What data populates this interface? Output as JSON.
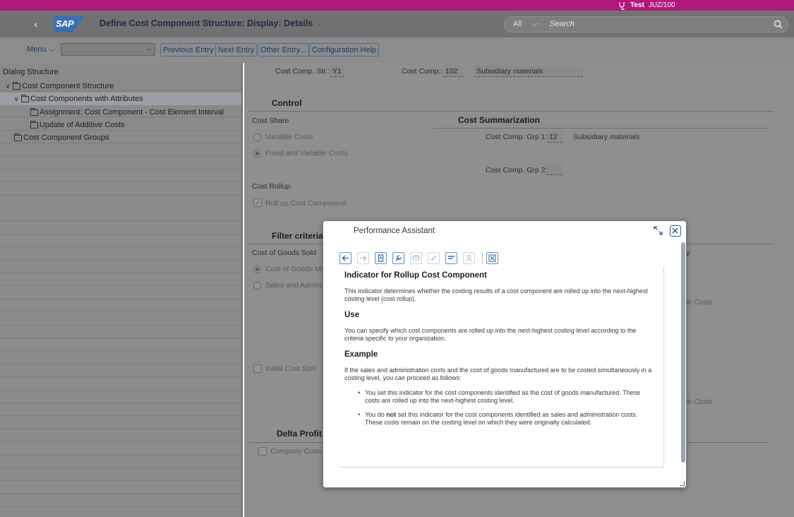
{
  "system": {
    "user": "Test",
    "client": "JUZ/100"
  },
  "shell": {
    "logo_text": "SAP",
    "title": "Define Cost Component Structure: Display: Details",
    "search_scope": "All",
    "search_placeholder": "Search"
  },
  "toolbar": {
    "menu_label": "Menu",
    "buttons": [
      "Previous Entry",
      "Next Entry",
      "Other Entry...",
      "Configuration Help"
    ]
  },
  "tree": {
    "header": "Dialog Structure",
    "nodes": [
      "Cost Component Structure",
      "Cost Components with Attributes",
      "Assignment: Cost Component - Cost Element Interval",
      "Update of Additive Costs",
      "Cost Component Groups"
    ]
  },
  "form": {
    "ccs_label": "Cost Comp. Str.:",
    "ccs_value": "Y1",
    "cc_label": "Cost Comp.:",
    "cc_value": "102",
    "cc_desc": "Subsidiary materials",
    "control_title": "Control",
    "cost_share_label": "Cost Share",
    "variable_costs": "Variable Costs",
    "fixed_variable_costs": "Fixed and Variable Costs",
    "cost_summ_title": "Cost Summarization",
    "grp1_label": "Cost Comp. Grp 1:",
    "grp1_value": "12",
    "grp1_desc": "Subsidiary materials",
    "grp2_label": "Cost Comp. Grp 2:",
    "cost_rollup_label": "Cost Rollup",
    "rollup_checkbox": "Roll up Cost Component",
    "filter_title": "Filter criteria",
    "cogs_label": "Cost of Goods Sold",
    "cogs_radio": "Cost of Goods Ma",
    "sales_radio": "Sales and Adminis",
    "initial_split": "Initial Cost Split",
    "delta_title": "Delta Profit",
    "company_code": "Company Code",
    "right_cut_1": "y",
    "right_cut_2": "le Costs",
    "right_cut_3": "le Costs"
  },
  "modal": {
    "title": "Performance Assistant",
    "heading": "Indicator for Rollup Cost Component",
    "intro": "This indicator determines whether the costing results of a cost component are rolled up into the next-highest costing level (cost rollup).",
    "use_title": "Use",
    "use_text": "You can specify which cost components are rolled up into the next-highest costing level according to the criteria specific to your organization.",
    "example_title": "Example",
    "example_text": "If the sales and administration costs and the cost of goods manufactured are to be costed simultaneously in a costing level, you can proceed as follows:",
    "bullet1": "You set this indicator for the cost components identified as the cost of goods manufactured. These costs are rolled up into the next-highest costing level.",
    "bullet2_pre": "You do ",
    "bullet2_bold": "not",
    "bullet2_post": " set this indicator for the cost components identified as sales and administration costs. These costs remain on the costing level on which they were originally calculated."
  },
  "colors": {
    "system_bar": "#b2177b",
    "sap_blue": "#3a6fb3",
    "link": "#2b5fa0"
  }
}
